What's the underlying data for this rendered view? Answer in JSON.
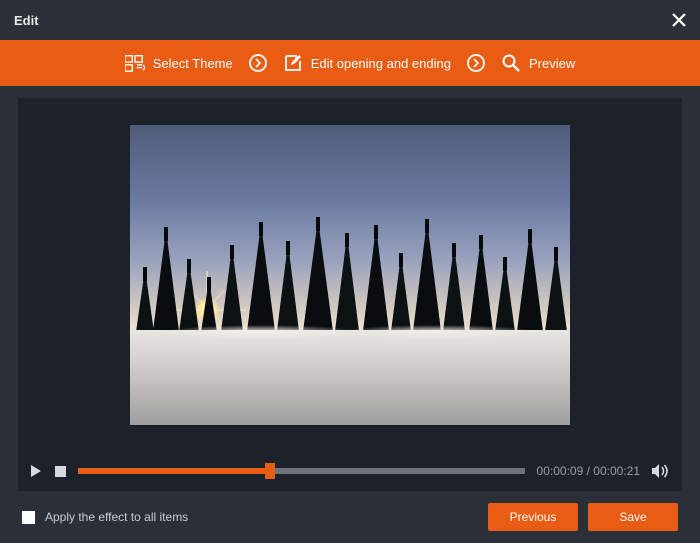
{
  "titlebar": {
    "title": "Edit"
  },
  "steps": {
    "select_theme": "Select Theme",
    "edit_opening": "Edit opening and ending",
    "preview": "Preview"
  },
  "playback": {
    "current": "00:00:09",
    "total": "00:00:21",
    "separator": " / ",
    "progress_percent": 43
  },
  "footer": {
    "apply_all": "Apply the effect to all items",
    "previous": "Previous",
    "save": "Save"
  },
  "colors": {
    "accent": "#e85c13",
    "bg": "#2a2f38",
    "panel": "#1d2129"
  }
}
